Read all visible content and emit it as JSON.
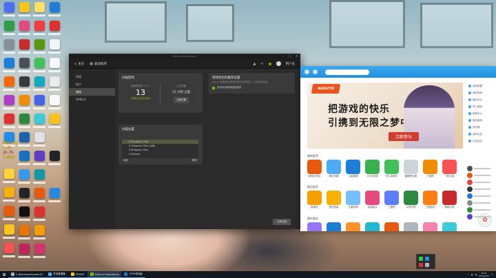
{
  "colors": {
    "nvidia_green": "#76b900",
    "gfe_bg": "#2b2b2b",
    "box_accent": "#2190e0",
    "taskbar": "#131820"
  },
  "desktop": {
    "sysmon": {
      "cpu": "CPU: 11",
      "line2": "1.2G",
      "line3": "24.7%",
      "line4": "1.0M/s"
    }
  },
  "gfe": {
    "window_title": "GeForce Experience",
    "nav": {
      "home": "主页",
      "drivers": "驱动程序",
      "icons": [
        "bell-icon",
        "share-icon",
        "settings-icon",
        "user-icon"
      ],
      "user_label": "用户名"
    },
    "sidebar": [
      {
        "label": "常规",
        "icon": "gear-icon"
      },
      {
        "label": "帐户",
        "icon": "user-icon"
      },
      {
        "label": "游戏",
        "icon": "game-icon",
        "active": true
      },
      {
        "label": "SHIELD",
        "icon": "shield-icon"
      }
    ],
    "scan_card": {
      "title": "扫描游戏",
      "found_label": "找到的游戏（个）",
      "found_count": "13",
      "last_scan_label": "上次扫描",
      "last_scan_value": "15 小时 之前",
      "optimize_link": "查看已优化的游戏",
      "scan_button": "立即扫描"
    },
    "recommend_card": {
      "title": "游戏优化的推荐设置",
      "desc": "NVIDIA 会根据您的硬件配置优化游戏设置，以获得最佳体验。",
      "checkbox_label": "自动优化新添加的游戏",
      "checked": true
    },
    "location_card": {
      "title": "扫描位置",
      "paths": [
        "D:\\Program Files",
        "E:\\Program Files (x86)",
        "F:\\Program Files",
        "G:\\Steam"
      ],
      "selected_index": 0,
      "add_label": "添加",
      "remove_label": "移除"
    },
    "save_button": "立即扫描"
  },
  "box4399": {
    "banner": {
      "logo": "NARUTO",
      "slogan_line1": "把游戏的快乐",
      "slogan_line2": "引携到无限之梦中",
      "cta": "立即参与"
    },
    "sections": [
      {
        "title": "最新推荐",
        "games": [
          "球球大作战",
          "奇幻乐园",
          "火柴英雄",
          "4399游戏",
          "开心消消乐",
          "偶像梦幻祭",
          "三国杀",
          "飞机大战"
        ]
      },
      {
        "title": "精品推荐",
        "games": [
          "航海王",
          "梦幻西游",
          "王者农场",
          "龙珠激斗",
          "三国杀",
          "斗罗大陆",
          "三国战记",
          "穿越火线"
        ]
      },
      {
        "title": "猜你喜欢",
        "games": []
      }
    ],
    "side_links": [
      "游戏设置",
      "我的游戏",
      "最近玩过",
      "热门游戏",
      "网游中心",
      "单机游戏",
      "排行榜",
      "游戏礼包",
      "论坛社区"
    ]
  },
  "taskbar": {
    "items": [
      {
        "label": "C:\\Windows\\System32",
        "active": false
      },
      {
        "label": "任务管理器",
        "active": false
      },
      {
        "label": "PPSSPP",
        "active": false
      },
      {
        "label": "GeForce Experience",
        "active": true
      },
      {
        "label": "4399游戏盒",
        "active": false
      }
    ],
    "time": "15:41",
    "date": "2019/4/21"
  }
}
